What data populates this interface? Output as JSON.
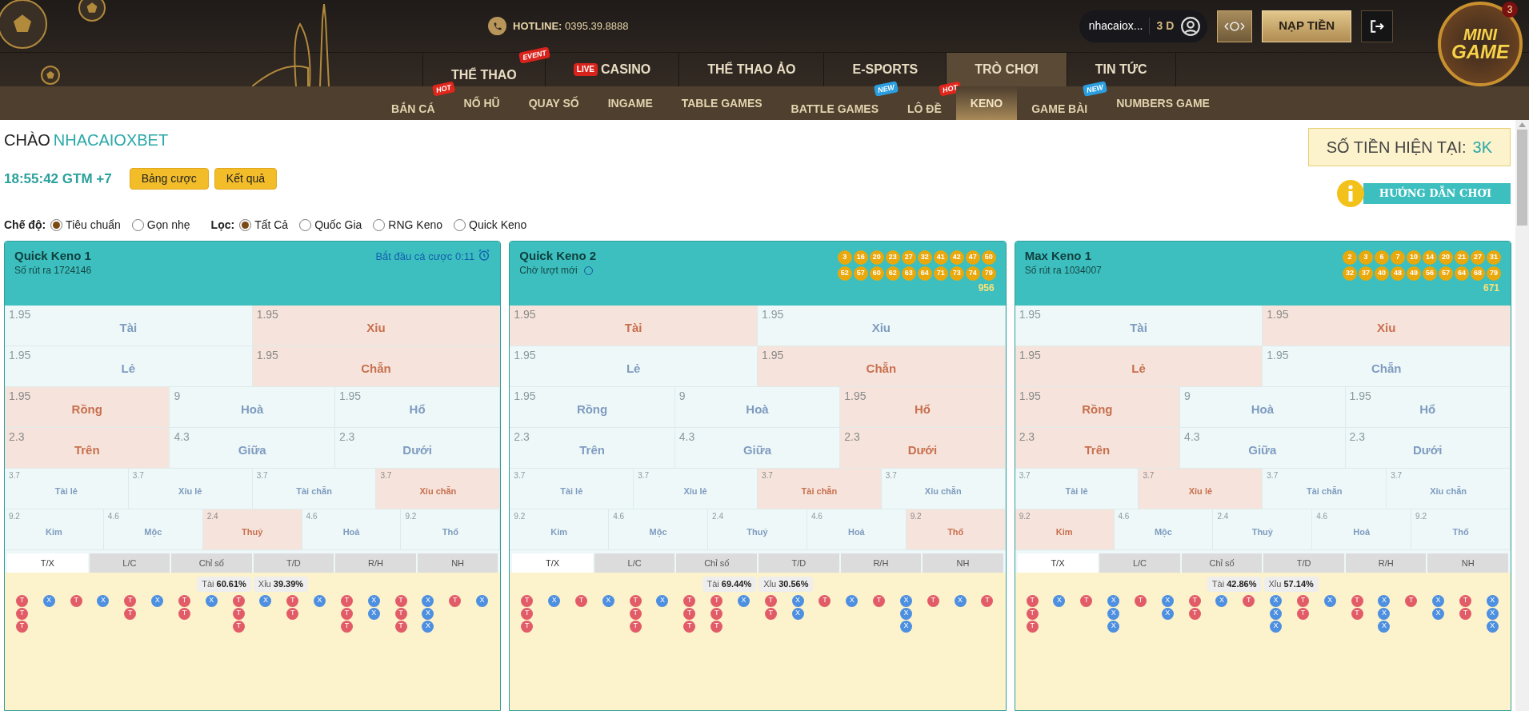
{
  "header": {
    "hotline_label": "HOTLINE:",
    "hotline": "0395.39.8888",
    "username": "nhacaiox...",
    "level": "3 D",
    "deposit": "NẠP TIỀN",
    "minigame": {
      "logo_top": "MINI",
      "logo_bottom": "GAME",
      "count": "3"
    }
  },
  "nav": [
    {
      "label": "THỂ THAO",
      "selected": false,
      "badge": {
        "text": "EVENT",
        "color": "#d8231c"
      }
    },
    {
      "label": "CASINO",
      "selected": false,
      "prefix": "LIVE"
    },
    {
      "label": "THỂ THAO ẢO",
      "selected": false
    },
    {
      "label": "E-SPORTS",
      "selected": false
    },
    {
      "label": "TRÒ CHƠI",
      "selected": true
    },
    {
      "label": "TIN TỨC",
      "selected": false
    }
  ],
  "subnav": [
    {
      "label": "BẮN CÁ",
      "selected": false,
      "badge": {
        "text": "HOT",
        "color": "#e0261b"
      }
    },
    {
      "label": "NỔ HŨ",
      "selected": false
    },
    {
      "label": "QUAY SỐ",
      "selected": false
    },
    {
      "label": "INGAME",
      "selected": false
    },
    {
      "label": "TABLE GAMES",
      "selected": false
    },
    {
      "label": "BATTLE GAMES",
      "selected": false,
      "badge": {
        "text": "NEW",
        "color": "#2a9ee0"
      }
    },
    {
      "label": "LÔ ĐỀ",
      "selected": false,
      "badge": {
        "text": "HOT",
        "color": "#e0261b"
      }
    },
    {
      "label": "KENO",
      "selected": true
    },
    {
      "label": "GAME BÀI",
      "selected": false,
      "badge": {
        "text": "NEW",
        "color": "#2a9ee0"
      }
    },
    {
      "label": "NUMBERS GAME",
      "selected": false
    }
  ],
  "greeting": {
    "label": "CHÀO",
    "name": "NHACAIOXBET"
  },
  "balance": {
    "label": "SỐ TIỀN HIỆN TẠI:",
    "value": "3K"
  },
  "clock": "18:55:42 GTM +7",
  "buttons": [
    "Bảng cược",
    "Kết quả"
  ],
  "guide": "HƯỚNG DẪN CHƠI",
  "filters": [
    {
      "label": "Chế độ:",
      "options": [
        {
          "label": "Tiêu chuẩn",
          "selected": true
        },
        {
          "label": "Gọn nhẹ",
          "selected": false
        }
      ]
    },
    {
      "label": "Lọc:",
      "options": [
        {
          "label": "Tất Cả",
          "selected": true
        },
        {
          "label": "Quốc Gia",
          "selected": false
        },
        {
          "label": "RNG Keno",
          "selected": false
        },
        {
          "label": "Quick Keno",
          "selected": false
        }
      ]
    }
  ],
  "panels": [
    {
      "title": "Quick Keno 1",
      "subtitle": "Số rút ra 1724146",
      "status": {
        "kind": "timer",
        "text": "Bắt đầu cá cược 0:11"
      },
      "bet_rows": [
        {
          "cells": [
            {
              "odds": "1.95",
              "label": "Tài",
              "won": false
            },
            {
              "odds": "1.95",
              "label": "Xỉu",
              "won": true
            }
          ]
        },
        {
          "cells": [
            {
              "odds": "1.95",
              "label": "Lẻ",
              "won": false
            },
            {
              "odds": "1.95",
              "label": "Chẵn",
              "won": true
            }
          ]
        },
        {
          "cells": [
            {
              "odds": "1.95",
              "label": "Rồng",
              "won": true
            },
            {
              "odds": "9",
              "label": "Hoà",
              "won": false
            },
            {
              "odds": "1.95",
              "label": "Hổ",
              "won": false
            }
          ]
        },
        {
          "cells": [
            {
              "odds": "2.3",
              "label": "Trên",
              "won": true
            },
            {
              "odds": "4.3",
              "label": "Giữa",
              "won": false
            },
            {
              "odds": "2.3",
              "label": "Dưới",
              "won": false
            }
          ]
        },
        {
          "cells": [
            {
              "odds": "3.7",
              "label": "Tài lẻ",
              "won": false
            },
            {
              "odds": "3.7",
              "label": "Xỉu lẻ",
              "won": false
            },
            {
              "odds": "3.7",
              "label": "Tài chẵn",
              "won": false
            },
            {
              "odds": "3.7",
              "label": "Xỉu chẵn",
              "won": true
            }
          ]
        },
        {
          "cells": [
            {
              "odds": "9.2",
              "label": "Kim",
              "won": false
            },
            {
              "odds": "4.6",
              "label": "Mộc",
              "won": false
            },
            {
              "odds": "2.4",
              "label": "Thuỷ",
              "won": true
            },
            {
              "odds": "4.6",
              "label": "Hoả",
              "won": false
            },
            {
              "odds": "9.2",
              "label": "Thổ",
              "won": false
            }
          ]
        }
      ],
      "tabs": [
        {
          "label": "T/X",
          "selected": true
        },
        {
          "label": "L/C",
          "selected": false
        },
        {
          "label": "Chỉ số",
          "selected": false
        },
        {
          "label": "T/D",
          "selected": false
        },
        {
          "label": "R/H",
          "selected": false
        },
        {
          "label": "NH",
          "selected": false
        }
      ],
      "stats": [
        "Tài **60.61%**",
        "Xỉu **39.39%**"
      ],
      "road": [
        [
          {
            "text": "T",
            "kind": "t"
          },
          {
            "text": "T",
            "kind": "t"
          },
          {
            "text": "T",
            "kind": "t"
          }
        ],
        [
          {
            "text": "X",
            "kind": "x"
          }
        ],
        [
          {
            "text": "T",
            "kind": "t"
          }
        ],
        [
          {
            "text": "X",
            "kind": "x"
          }
        ],
        [
          {
            "text": "T",
            "kind": "t"
          },
          {
            "text": "T",
            "kind": "t"
          }
        ],
        [
          {
            "text": "X",
            "kind": "x"
          }
        ],
        [
          {
            "text": "T",
            "kind": "t"
          },
          {
            "text": "T",
            "kind": "t"
          }
        ],
        [
          {
            "text": "X",
            "kind": "x"
          }
        ],
        [
          {
            "text": "T",
            "kind": "t"
          },
          {
            "text": "T",
            "kind": "t"
          },
          {
            "text": "T",
            "kind": "t"
          }
        ],
        [
          {
            "text": "X",
            "kind": "x"
          }
        ],
        [
          {
            "text": "T",
            "kind": "t"
          },
          {
            "text": "T",
            "kind": "t"
          }
        ],
        [
          {
            "text": "X",
            "kind": "x"
          }
        ],
        [
          {
            "text": "T",
            "kind": "t"
          },
          {
            "text": "T",
            "kind": "t"
          },
          {
            "text": "T",
            "kind": "t"
          }
        ],
        [
          {
            "text": "X",
            "kind": "x"
          },
          {
            "text": "X",
            "kind": "x"
          }
        ],
        [
          {
            "text": "T",
            "kind": "t"
          },
          {
            "text": "T",
            "kind": "t"
          },
          {
            "text": "T",
            "kind": "t"
          }
        ],
        [
          {
            "text": "X",
            "kind": "x"
          },
          {
            "text": "X",
            "kind": "x"
          },
          {
            "text": "X",
            "kind": "x"
          }
        ],
        [
          {
            "text": "T",
            "kind": "t"
          }
        ],
        [
          {
            "text": "X",
            "kind": "x"
          }
        ]
      ]
    },
    {
      "title": "Quick Keno 2",
      "subtitle": "Chờ lượt mới",
      "status": {
        "kind": "waiting"
      },
      "balls": [
        "3",
        "16",
        "20",
        "23",
        "27",
        "32",
        "41",
        "42",
        "47",
        "50",
        "52",
        "57",
        "60",
        "62",
        "63",
        "64",
        "71",
        "73",
        "74",
        "79"
      ],
      "total": "956",
      "bet_rows": [
        {
          "cells": [
            {
              "odds": "1.95",
              "label": "Tài",
              "won": true
            },
            {
              "odds": "1.95",
              "label": "Xỉu",
              "won": false
            }
          ]
        },
        {
          "cells": [
            {
              "odds": "1.95",
              "label": "Lẻ",
              "won": false
            },
            {
              "odds": "1.95",
              "label": "Chẵn",
              "won": true
            }
          ]
        },
        {
          "cells": [
            {
              "odds": "1.95",
              "label": "Rồng",
              "won": false
            },
            {
              "odds": "9",
              "label": "Hoà",
              "won": false
            },
            {
              "odds": "1.95",
              "label": "Hổ",
              "won": true
            }
          ]
        },
        {
          "cells": [
            {
              "odds": "2.3",
              "label": "Trên",
              "won": false
            },
            {
              "odds": "4.3",
              "label": "Giữa",
              "won": false
            },
            {
              "odds": "2.3",
              "label": "Dưới",
              "won": true
            }
          ]
        },
        {
          "cells": [
            {
              "odds": "3.7",
              "label": "Tài lẻ",
              "won": false
            },
            {
              "odds": "3.7",
              "label": "Xỉu lẻ",
              "won": false
            },
            {
              "odds": "3.7",
              "label": "Tài chẵn",
              "won": true
            },
            {
              "odds": "3.7",
              "label": "Xỉu chẵn",
              "won": false
            }
          ]
        },
        {
          "cells": [
            {
              "odds": "9.2",
              "label": "Kim",
              "won": false
            },
            {
              "odds": "4.6",
              "label": "Mộc",
              "won": false
            },
            {
              "odds": "2.4",
              "label": "Thuỷ",
              "won": false
            },
            {
              "odds": "4.6",
              "label": "Hoả",
              "won": false
            },
            {
              "odds": "9.2",
              "label": "Thổ",
              "won": true
            }
          ]
        }
      ],
      "tabs": [
        {
          "label": "T/X",
          "selected": true
        },
        {
          "label": "L/C",
          "selected": false
        },
        {
          "label": "Chỉ số",
          "selected": false
        },
        {
          "label": "T/D",
          "selected": false
        },
        {
          "label": "R/H",
          "selected": false
        },
        {
          "label": "NH",
          "selected": false
        }
      ],
      "stats": [
        "Tài **69.44%**",
        "Xỉu **30.56%**"
      ],
      "road": [
        [
          {
            "text": "T",
            "kind": "t"
          },
          {
            "text": "T",
            "kind": "t"
          },
          {
            "text": "T",
            "kind": "t"
          }
        ],
        [
          {
            "text": "X",
            "kind": "x"
          }
        ],
        [
          {
            "text": "T",
            "kind": "t"
          }
        ],
        [
          {
            "text": "X",
            "kind": "x"
          }
        ],
        [
          {
            "text": "T",
            "kind": "t"
          },
          {
            "text": "T",
            "kind": "t"
          },
          {
            "text": "T",
            "kind": "t"
          }
        ],
        [
          {
            "text": "X",
            "kind": "x"
          }
        ],
        [
          {
            "text": "T",
            "kind": "t"
          },
          {
            "text": "T",
            "kind": "t"
          },
          {
            "text": "T",
            "kind": "t"
          }
        ],
        [
          {
            "text": "T",
            "kind": "t"
          },
          {
            "text": "T",
            "kind": "t"
          },
          {
            "text": "T",
            "kind": "t"
          }
        ],
        [
          {
            "text": "X",
            "kind": "x"
          }
        ],
        [
          {
            "text": "T",
            "kind": "t"
          },
          {
            "text": "T",
            "kind": "t"
          }
        ],
        [
          {
            "text": "X",
            "kind": "x"
          },
          {
            "text": "X",
            "kind": "x"
          }
        ],
        [
          {
            "text": "T",
            "kind": "t"
          }
        ],
        [
          {
            "text": "X",
            "kind": "x"
          }
        ],
        [
          {
            "text": "T",
            "kind": "t"
          }
        ],
        [
          {
            "text": "X",
            "kind": "x"
          },
          {
            "text": "X",
            "kind": "x"
          },
          {
            "text": "X",
            "kind": "x"
          }
        ],
        [
          {
            "text": "T",
            "kind": "t"
          }
        ],
        [
          {
            "text": "X",
            "kind": "x"
          }
        ],
        [
          {
            "text": "T",
            "kind": "t"
          }
        ]
      ]
    },
    {
      "title": "Max Keno 1",
      "subtitle": "Số rút ra 1034007",
      "status": {
        "kind": "none"
      },
      "balls": [
        "2",
        "3",
        "6",
        "7",
        "10",
        "14",
        "20",
        "21",
        "27",
        "31",
        "32",
        "37",
        "40",
        "48",
        "49",
        "56",
        "57",
        "64",
        "68",
        "79"
      ],
      "total": "671",
      "bet_rows": [
        {
          "cells": [
            {
              "odds": "1.95",
              "label": "Tài",
              "won": false
            },
            {
              "odds": "1.95",
              "label": "Xỉu",
              "won": true
            }
          ]
        },
        {
          "cells": [
            {
              "odds": "1.95",
              "label": "Lẻ",
              "won": true
            },
            {
              "odds": "1.95",
              "label": "Chẵn",
              "won": false
            }
          ]
        },
        {
          "cells": [
            {
              "odds": "1.95",
              "label": "Rồng",
              "won": true
            },
            {
              "odds": "9",
              "label": "Hoà",
              "won": false
            },
            {
              "odds": "1.95",
              "label": "Hổ",
              "won": false
            }
          ]
        },
        {
          "cells": [
            {
              "odds": "2.3",
              "label": "Trên",
              "won": true
            },
            {
              "odds": "4.3",
              "label": "Giữa",
              "won": false
            },
            {
              "odds": "2.3",
              "label": "Dưới",
              "won": false
            }
          ]
        },
        {
          "cells": [
            {
              "odds": "3.7",
              "label": "Tài lẻ",
              "won": false
            },
            {
              "odds": "3.7",
              "label": "Xỉu lẻ",
              "won": true
            },
            {
              "odds": "3.7",
              "label": "Tài chẵn",
              "won": false
            },
            {
              "odds": "3.7",
              "label": "Xỉu chẵn",
              "won": false
            }
          ]
        },
        {
          "cells": [
            {
              "odds": "9.2",
              "label": "Kim",
              "won": true
            },
            {
              "odds": "4.6",
              "label": "Mộc",
              "won": false
            },
            {
              "odds": "2.4",
              "label": "Thuỷ",
              "won": false
            },
            {
              "odds": "4.6",
              "label": "Hoả",
              "won": false
            },
            {
              "odds": "9.2",
              "label": "Thổ",
              "won": false
            }
          ]
        }
      ],
      "tabs": [
        {
          "label": "T/X",
          "selected": true
        },
        {
          "label": "L/C",
          "selected": false
        },
        {
          "label": "Chỉ số",
          "selected": false
        },
        {
          "label": "T/D",
          "selected": false
        },
        {
          "label": "R/H",
          "selected": false
        },
        {
          "label": "NH",
          "selected": false
        }
      ],
      "stats": [
        "Tài **42.86%**",
        "Xỉu **57.14%**"
      ],
      "road": [
        [
          {
            "text": "T",
            "kind": "t"
          },
          {
            "text": "T",
            "kind": "t"
          },
          {
            "text": "T",
            "kind": "t"
          }
        ],
        [
          {
            "text": "X",
            "kind": "x"
          }
        ],
        [
          {
            "text": "T",
            "kind": "t"
          }
        ],
        [
          {
            "text": "X",
            "kind": "x"
          },
          {
            "text": "X",
            "kind": "x"
          },
          {
            "text": "X",
            "kind": "x"
          }
        ],
        [
          {
            "text": "T",
            "kind": "t"
          }
        ],
        [
          {
            "text": "X",
            "kind": "x"
          },
          {
            "text": "X",
            "kind": "x"
          }
        ],
        [
          {
            "text": "T",
            "kind": "t"
          },
          {
            "text": "T",
            "kind": "t"
          }
        ],
        [
          {
            "text": "X",
            "kind": "x"
          }
        ],
        [
          {
            "text": "T",
            "kind": "t"
          }
        ],
        [
          {
            "text": "X",
            "kind": "x"
          },
          {
            "text": "X",
            "kind": "x"
          },
          {
            "text": "X",
            "kind": "x"
          }
        ],
        [
          {
            "text": "T",
            "kind": "t"
          },
          {
            "text": "T",
            "kind": "t"
          }
        ],
        [
          {
            "text": "X",
            "kind": "x"
          }
        ],
        [
          {
            "text": "T",
            "kind": "t"
          },
          {
            "text": "T",
            "kind": "t"
          }
        ],
        [
          {
            "text": "X",
            "kind": "x"
          },
          {
            "text": "X",
            "kind": "x"
          },
          {
            "text": "X",
            "kind": "x"
          }
        ],
        [
          {
            "text": "T",
            "kind": "t"
          }
        ],
        [
          {
            "text": "X",
            "kind": "x"
          },
          {
            "text": "X",
            "kind": "x"
          }
        ],
        [
          {
            "text": "T",
            "kind": "t"
          },
          {
            "text": "T",
            "kind": "t"
          }
        ],
        [
          {
            "text": "X",
            "kind": "x"
          },
          {
            "text": "X",
            "kind": "x"
          },
          {
            "text": "X",
            "kind": "x"
          }
        ]
      ]
    }
  ]
}
